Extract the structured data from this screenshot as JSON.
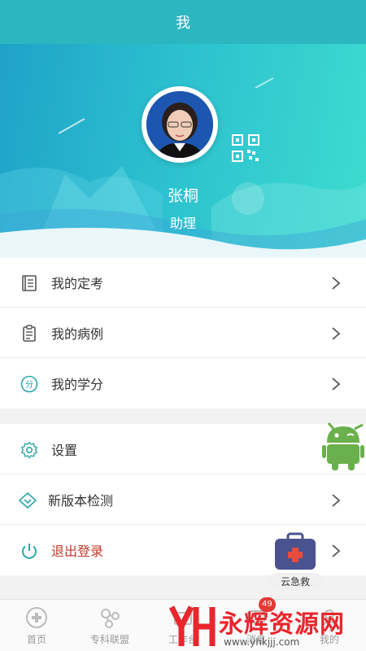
{
  "header": {
    "title": "我"
  },
  "profile": {
    "name": "张桐",
    "role": "助理"
  },
  "menu_group_1": [
    {
      "label": "我的定考",
      "icon": "exam-book-icon"
    },
    {
      "label": "我的病例",
      "icon": "clipboard-icon"
    },
    {
      "label": "我的学分",
      "icon": "credit-score-icon"
    }
  ],
  "menu_group_2": [
    {
      "label": "设置",
      "icon": "gear-icon"
    },
    {
      "label": "新版本检测",
      "icon": "diamond-check-icon"
    },
    {
      "label": "退出登录",
      "icon": "power-icon",
      "color": "#c0392b"
    }
  ],
  "tabbar": [
    {
      "label": "首页",
      "icon": "home-cross-icon"
    },
    {
      "label": "专科联盟",
      "icon": "network-icon"
    },
    {
      "label": "工作台",
      "icon": "workbench-icon"
    },
    {
      "label": "消息",
      "icon": "message-icon",
      "badge": "49"
    },
    {
      "label": "我的",
      "icon": "user-icon"
    }
  ],
  "floating": {
    "firstaid_label": "云急救"
  },
  "watermark": {
    "text": "永辉资源网",
    "url": "www.yhkjjj.com"
  },
  "colors": {
    "accent": "#2cb6bf",
    "logout": "#c0392b",
    "badge": "#e53935"
  }
}
